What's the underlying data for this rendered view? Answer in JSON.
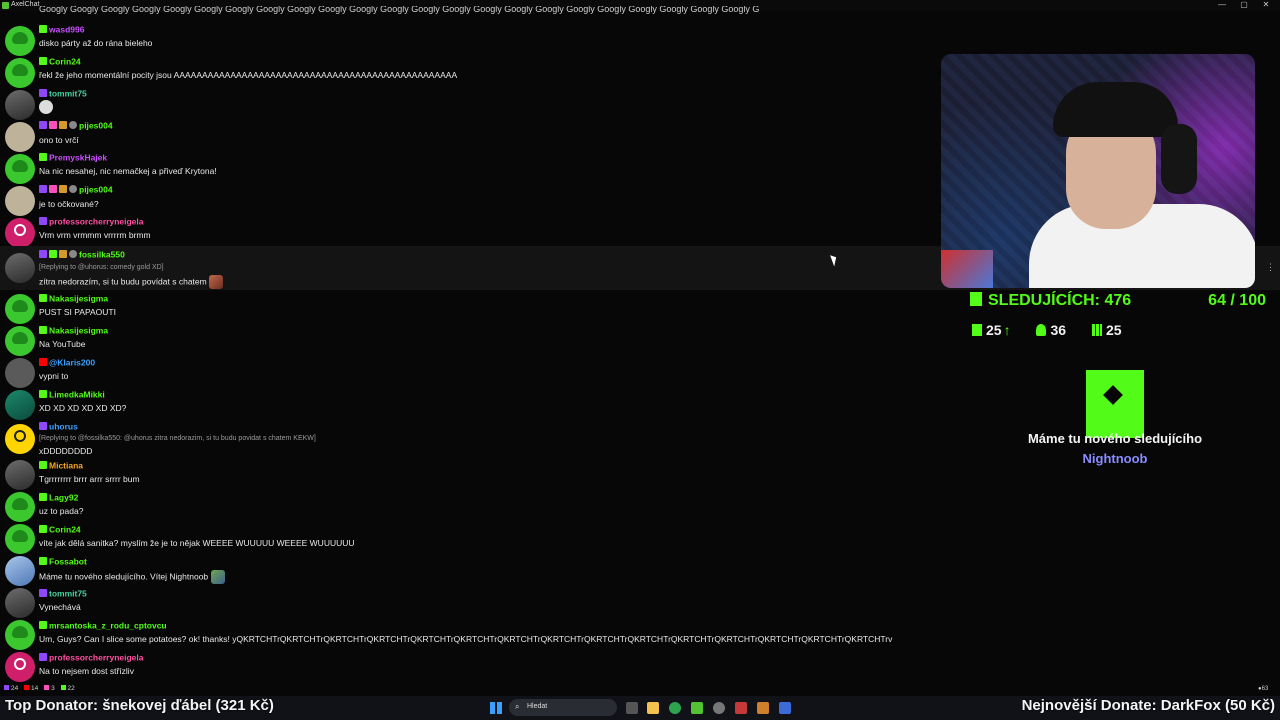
{
  "window": {
    "app_title": "AxelChat",
    "controls": [
      "—",
      "▢",
      "✕"
    ]
  },
  "top_cut_text": "Googly Googly Googly Googly Googly Googly Googly Googly Googly Googly Googly Googly Googly Googly Googly Googly Googly Googly Googly Googly Googly Googly Googly Googly Googly Googly Googly Googly Googly Googly Googly",
  "messages": [
    {
      "user": "wasd996",
      "color": "#c94fff",
      "text": "disko párty až do rána bieleho"
    },
    {
      "user": "Corin24",
      "color": "#53fc18",
      "text": "řekl že jeho momentální pocity jsou AAAAAAAAAAAAAAAAAAAAAAAAAAAAAAAAAAAAAAAAAAAAAAAAAA"
    },
    {
      "user": "tommit75",
      "color": "#46d3a0",
      "text": ""
    },
    {
      "user": "pijes004",
      "color": "#53fc18",
      "text": "ono to vrčí"
    },
    {
      "user": "PremyskHajek",
      "color": "#c94fff",
      "text": "Na nic nesahej, nic nemačkej a přiveď Krytona!"
    },
    {
      "user": "pijes004",
      "color": "#53fc18",
      "text": "je to očkované?"
    },
    {
      "user": "professorcherryneigela",
      "color": "#ff4fa0",
      "text": "Vrm vrm vrmmm vrrrrm brmm"
    },
    {
      "user": "fossilka550",
      "color": "#53fc18",
      "reply": "[Replying to @uhorus: comedy gold XD]",
      "text": "zítra nedorazím, si tu budu povídat s chatem"
    },
    {
      "user": "Nakasijesigma",
      "color": "#53fc18",
      "text": "PUST SI PAPAOUTI"
    },
    {
      "user": "Nakasijesigma",
      "color": "#53fc18",
      "text": "Na YouTube"
    },
    {
      "user": "@Klaris200",
      "color": "#3aa0ff",
      "text": "vypni to"
    },
    {
      "user": "LimedkaMikki",
      "color": "#53fc18",
      "text": "XD XD XD XD XD XD?"
    },
    {
      "user": "uhorus",
      "color": "#3aa0ff",
      "reply": "[Replying to @fossilka550: @uhorus zitra nedorazim, si tu budu povidat s chatem KEKW]",
      "text": "xDDDDDDDD"
    },
    {
      "user": "Mictiana",
      "color": "#f5a623",
      "text": "Tgrrrrrrrr brrr arrr srrrr bum"
    },
    {
      "user": "Lagy92",
      "color": "#53fc18",
      "text": "uz to pada?"
    },
    {
      "user": "Corin24",
      "color": "#53fc18",
      "text": "víte jak dělá sanitka? myslím že je to nějak WEEEE WUUUUU WEEEE WUUUUUU"
    },
    {
      "user": "Fossabot",
      "color": "#53fc18",
      "text": "Máme tu nového sledujícího. Vítej Nightnoob"
    },
    {
      "user": "tommit75",
      "color": "#46d3a0",
      "text": "Vynechává"
    },
    {
      "user": "mrsantoska_z_rodu_cptovcu",
      "color": "#53fc18",
      "text": "Um, Guys? Can I slice some potatoes? ok! thanks! yQKRTCHTrQKRTCHTrQKRTCHTrQKRTCHTrQKRTCHTrQKRTCHTrQKRTCHTrQKRTCHTrQKRTCHTrQKRTCHTrQKRTCHTrQKRTCHTrQKRTCHTrQKRTCHTrQKRTCHTrv"
    },
    {
      "user": "professorcherryneigela",
      "color": "#ff4fa0",
      "text": "Na to nejsem dost střízliv"
    }
  ],
  "stats": {
    "followers_label": "SLEDUJÍCÍCH: 476",
    "goal": "64 / 100",
    "kick_count": "25",
    "viewers": "36",
    "chart_count": "25"
  },
  "alert": {
    "headline": "Máme tu nového sledujícího",
    "name": "Nightnoob"
  },
  "counters": {
    "a": "24",
    "b": "14",
    "c": "3",
    "d": "22"
  },
  "footer": {
    "top_donator": "Top Donator: šnekovej ďábel (321 Kč)",
    "latest_donate": "Nejnovější Donate: DarkFox (50 Kč)"
  },
  "taskbar": {
    "search_placeholder": "Hledat"
  },
  "colors": {
    "kick_green": "#53fc18",
    "alert_name": "#8a8cff"
  }
}
